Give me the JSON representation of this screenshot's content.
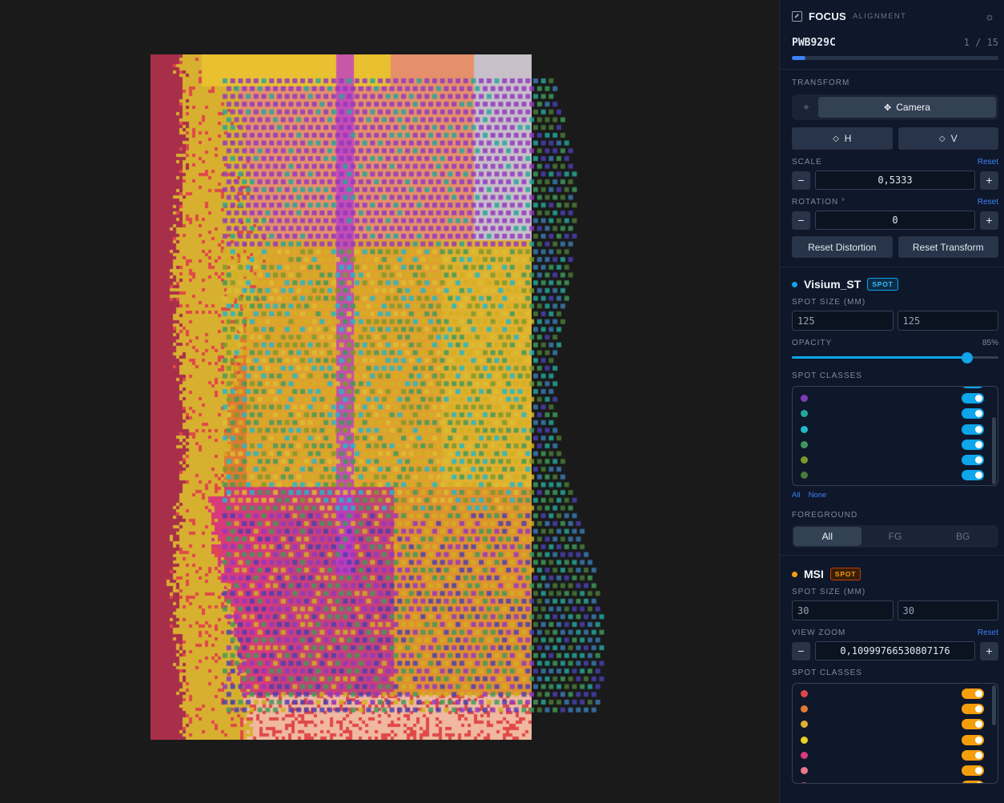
{
  "app": {
    "brand": "FOCUS",
    "subtitle": "ALIGNMENT"
  },
  "sample": {
    "name": "PWB929C",
    "counter": "1 / 15",
    "progress_fraction": 0.0667
  },
  "transform": {
    "section_label": "TRANSFORM",
    "mode_camera_label": "Camera",
    "flip_h_label": "H",
    "flip_v_label": "V",
    "scale_label": "SCALE",
    "scale_value": "0,5333",
    "rotation_label": "ROTATION °",
    "rotation_value": "0",
    "reset_label": "Reset",
    "reset_distortion_label": "Reset Distortion",
    "reset_transform_label": "Reset Transform"
  },
  "layers": {
    "visium": {
      "name": "Visium_ST",
      "badge": "SPOT",
      "dot_color": "#0ea5e9",
      "spot_size_label": "SPOT SIZE (MM)",
      "spot_size_x": "125",
      "spot_size_y": "125",
      "opacity_label": "OPACITY",
      "opacity_text": "85%",
      "opacity_value": 0.85,
      "classes_label": "SPOT CLASSES",
      "class_colors": [
        "#7e3bb5",
        "#26a69a",
        "#22b8c8",
        "#3f9a5a",
        "#7a9a2a",
        "#4a7a3a"
      ],
      "all_label": "All",
      "none_label": "None",
      "foreground_label": "FOREGROUND",
      "fg_options": [
        "All",
        "FG",
        "BG"
      ],
      "toggle_color": "#0ea5e9"
    },
    "msi": {
      "name": "MSI",
      "badge": "SPOT",
      "dot_color": "#f59e0b",
      "spot_size_label": "SPOT SIZE (MM)",
      "spot_size_x": "30",
      "spot_size_y": "30",
      "view_zoom_label": "VIEW ZOOM",
      "view_zoom_value": "0,10999766530807176",
      "reset_label": "Reset",
      "classes_label": "SPOT CLASSES",
      "class_colors": [
        "#e04848",
        "#e07a30",
        "#e0b030",
        "#e8d020",
        "#d83a7a",
        "#e87a8a"
      ],
      "toggle_color": "#f59e0b"
    }
  }
}
